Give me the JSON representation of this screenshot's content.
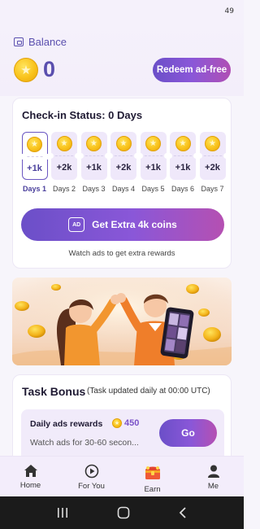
{
  "status": {
    "signal": "49"
  },
  "balance": {
    "label": "Balance",
    "value": "0",
    "redeem_label": "Redeem ad-free"
  },
  "checkin": {
    "title": "Check-in Status: 0 Days",
    "days": [
      {
        "amount": "+1k",
        "label": "Days 1"
      },
      {
        "amount": "+2k",
        "label": "Days 2"
      },
      {
        "amount": "+1k",
        "label": "Days 3"
      },
      {
        "amount": "+2k",
        "label": "Days 4"
      },
      {
        "amount": "+1k",
        "label": "Days 5"
      },
      {
        "amount": "+1k",
        "label": "Days 6"
      },
      {
        "amount": "+2k",
        "label": "Days 7"
      }
    ],
    "extra_button": "Get Extra 4k coins",
    "ad_icon": "AD",
    "caption": "Watch ads to get extra rewards"
  },
  "task": {
    "title": "Task Bonus",
    "subtitle": "(Task updated daily at 00:00 UTC)",
    "item": {
      "name": "Daily ads rewards",
      "reward": "450",
      "desc": "Watch ads for 30-60 secon...",
      "button": "Go"
    }
  },
  "nav": {
    "items": [
      {
        "label": "Home",
        "icon": "home-icon"
      },
      {
        "label": "For You",
        "icon": "play-circle-icon"
      },
      {
        "label": "Earn",
        "icon": "treasure-chest-icon"
      },
      {
        "label": "Me",
        "icon": "person-icon"
      }
    ]
  },
  "colors": {
    "accent": "#6b4fc8",
    "accent_end": "#b550b2",
    "brand_text": "#5a4fae"
  }
}
